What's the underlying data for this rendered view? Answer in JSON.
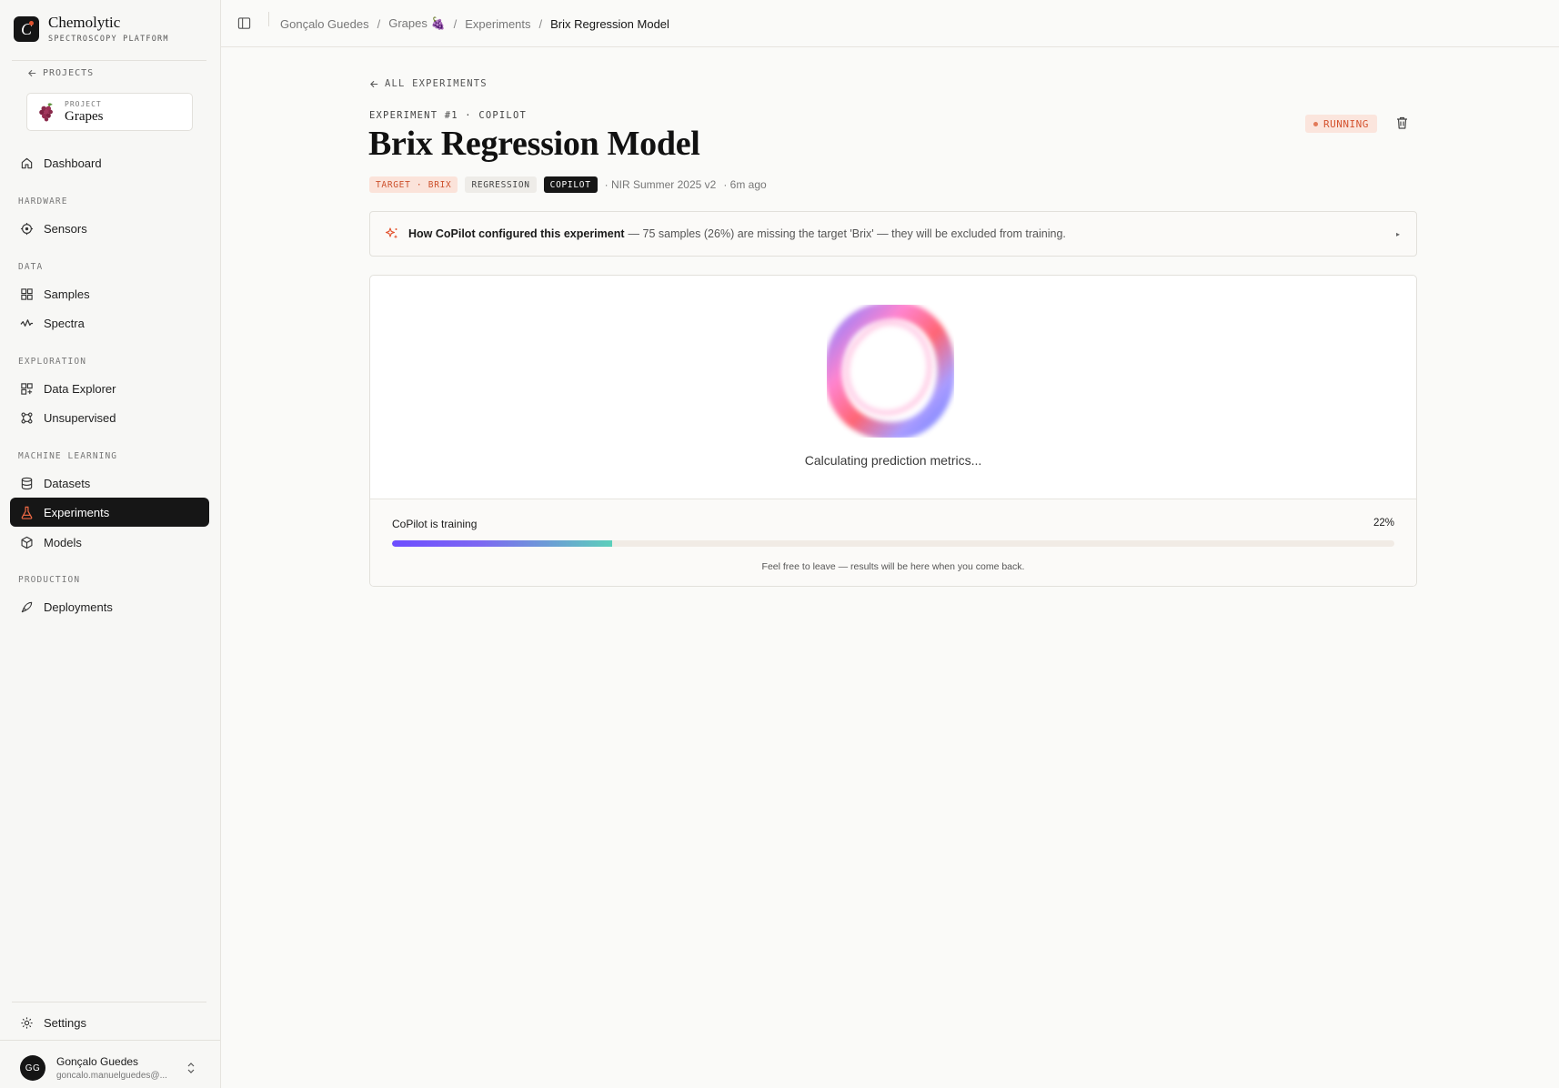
{
  "brand": {
    "name": "Chemolytic",
    "subtitle": "SPECTROSCOPY PLATFORM",
    "logo_letter": "C"
  },
  "sidebar": {
    "projects_link": "PROJECTS",
    "project": {
      "label": "PROJECT",
      "name": "Grapes"
    },
    "dashboard": "Dashboard",
    "sections": {
      "hardware": "HARDWARE",
      "data": "DATA",
      "exploration": "EXPLORATION",
      "machine_learning": "MACHINE LEARNING",
      "production": "PRODUCTION"
    },
    "items": {
      "sensors": "Sensors",
      "samples": "Samples",
      "spectra": "Spectra",
      "data_explorer": "Data Explorer",
      "unsupervised": "Unsupervised",
      "datasets": "Datasets",
      "experiments": "Experiments",
      "models": "Models",
      "deployments": "Deployments"
    },
    "settings": "Settings",
    "user": {
      "initials": "GG",
      "name": "Gonçalo Guedes",
      "email": "goncalo.manuelguedes@..."
    }
  },
  "breadcrumb": {
    "user": "Gonçalo Guedes",
    "project": "Grapes 🍇",
    "section": "Experiments",
    "current": "Brix Regression Model",
    "separator": "/"
  },
  "experiment": {
    "back_link": "ALL EXPERIMENTS",
    "meta": "EXPERIMENT #1 · COPILOT",
    "title": "Brix Regression Model",
    "status": "RUNNING",
    "tags": {
      "target": "TARGET · BRIX",
      "type": "REGRESSION",
      "mode": "COPILOT"
    },
    "dataset": "· NIR Summer 2025 v2",
    "age": "· 6m ago"
  },
  "info_bar": {
    "lead": "How CoPilot configured this experiment",
    "message": "— 75 samples (26%) are missing the target 'Brix' — they will be excluded from training.",
    "caret": "▸"
  },
  "training": {
    "status_text": "Calculating prediction metrics...",
    "label": "CoPilot is training",
    "percent_label": "22%",
    "progress": 0.22,
    "note": "Feel free to leave — results will be here when you come back."
  },
  "colors": {
    "accent": "#e3532f",
    "active_nav_bg": "#161616",
    "progress_start": "#6d4dff",
    "progress_end": "#5ccfbb"
  }
}
